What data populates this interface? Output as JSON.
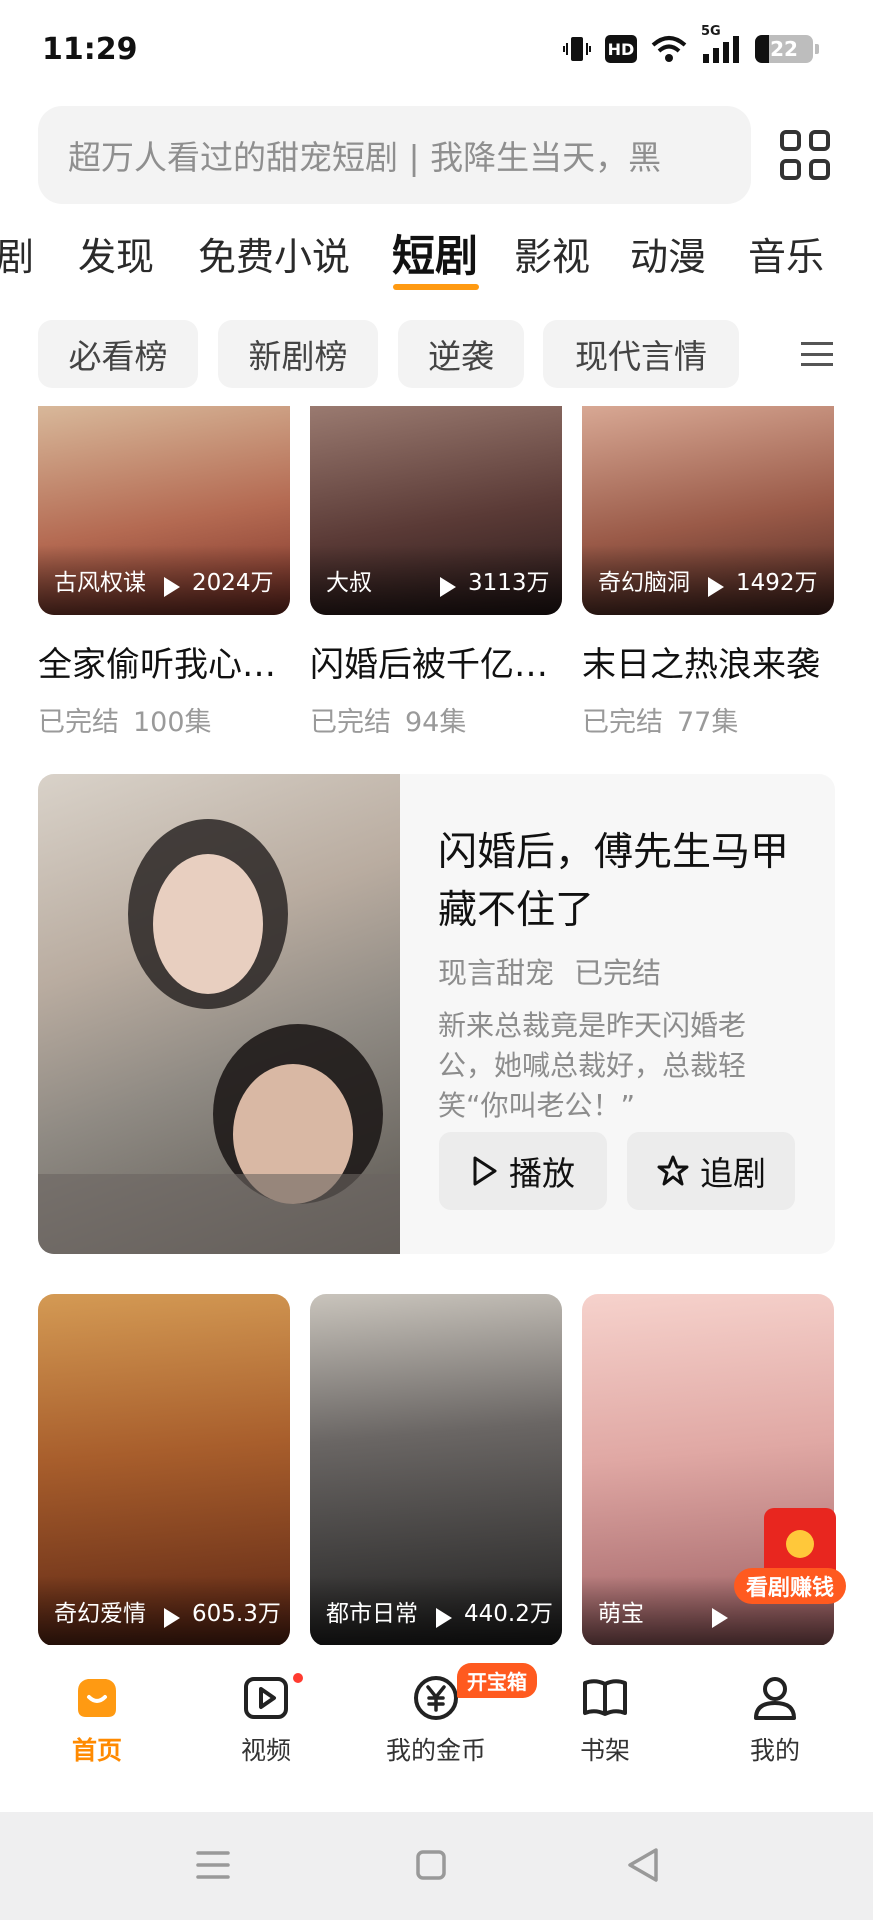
{
  "status_bar": {
    "time": "11:29",
    "network": "5G",
    "hd": "HD",
    "battery": "22"
  },
  "search": {
    "placeholder": "超万人看过的甜宠短剧 | 我降生当天，黑"
  },
  "tabs": [
    {
      "label": "剧"
    },
    {
      "label": "发现"
    },
    {
      "label": "免费小说"
    },
    {
      "label": "短剧",
      "active": true
    },
    {
      "label": "影视"
    },
    {
      "label": "动漫"
    },
    {
      "label": "音乐"
    }
  ],
  "chips": [
    {
      "label": "必看榜"
    },
    {
      "label": "新剧榜"
    },
    {
      "label": "逆袭"
    },
    {
      "label": "现代言情"
    }
  ],
  "row1": [
    {
      "tag": "古风权谋",
      "plays": "2024万",
      "title": "全家偷听我心…",
      "status": "已完结",
      "episodes": "100集",
      "colors": [
        "#c9a98a",
        "#9a4a3a"
      ]
    },
    {
      "tag": "大叔",
      "plays": "3113万",
      "title": "闪婚后被千亿…",
      "status": "已完结",
      "episodes": "94集",
      "colors": [
        "#8a7068",
        "#3a2a28"
      ]
    },
    {
      "tag": "奇幻脑洞",
      "plays": "1492万",
      "title": "末日之热浪来袭",
      "status": "已完结",
      "episodes": "77集",
      "colors": [
        "#c08c78",
        "#6a3a30"
      ]
    }
  ],
  "featured": {
    "title": "闪婚后，傅先生马甲藏不住了",
    "genre": "现言甜宠",
    "status": "已完结",
    "description": "新来总裁竟是昨天闪婚老公，她喊总裁好，总裁轻笑“你叫老公！”",
    "play_label": "播放",
    "follow_label": "追剧"
  },
  "row2": [
    {
      "tag": "奇幻爱情",
      "plays": "605.3万",
      "colors": [
        "#c88c4a",
        "#6a2a18"
      ]
    },
    {
      "tag": "都市日常",
      "plays": "440.2万",
      "colors": [
        "#8a8a8a",
        "#2a2a2a"
      ]
    },
    {
      "tag": "萌宝",
      "plays": "",
      "colors": [
        "#f0c4c0",
        "#b07070"
      ]
    }
  ],
  "float_reward": {
    "label": "看剧赚钱"
  },
  "bottom_nav": [
    {
      "label": "首页",
      "active": true
    },
    {
      "label": "视频"
    },
    {
      "label": "我的金币",
      "badge": "开宝箱"
    },
    {
      "label": "书架"
    },
    {
      "label": "我的"
    }
  ],
  "colors": {
    "accent": "#ff8a00",
    "badge": "#ff5a1f",
    "chip_bg": "#f3f3f3"
  }
}
